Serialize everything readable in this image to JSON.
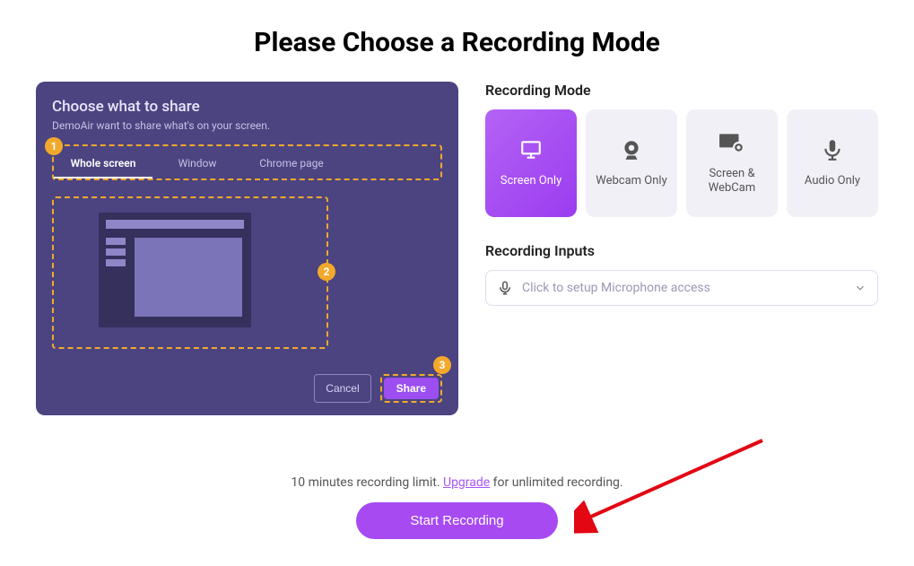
{
  "title": "Please Choose a Recording Mode",
  "share_panel": {
    "heading": "Choose what to share",
    "subtext": "DemoAir want to share what's on your screen.",
    "tabs": {
      "whole": "Whole screen",
      "window": "Window",
      "chrome_page": "Chrome page"
    },
    "badges": {
      "b1": "1",
      "b2": "2",
      "b3": "3"
    },
    "cancel": "Cancel",
    "share": "Share"
  },
  "recording_mode": {
    "label": "Recording Mode",
    "cards": {
      "screen_only": "Screen Only",
      "webcam_only": "Webcam Only",
      "screen_webcam": "Screen & WebCam",
      "audio_only": "Audio Only"
    }
  },
  "recording_inputs": {
    "label": "Recording Inputs",
    "placeholder": "Click to setup Microphone access"
  },
  "footer": {
    "limit_pre": "10 minutes recording limit. ",
    "upgrade": "Upgrade",
    "limit_post": " for unlimited recording.",
    "start": "Start Recording"
  }
}
